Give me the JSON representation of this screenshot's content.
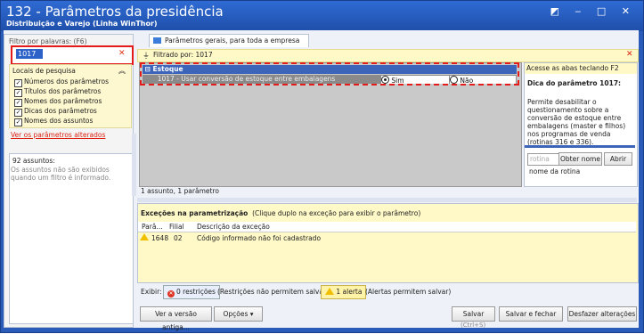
{
  "window": {
    "title": "132 - Parâmetros da presidência",
    "subtitle": "Distribuição e Varejo (Linha WinThor)",
    "controls": "◩ ‒ □ ✕"
  },
  "left": {
    "filter_label": "Filtro por palavras: (F6)",
    "filter_value": "1017",
    "search_places_title": "Locais de pesquisa",
    "search_places": [
      "Números dos parâmetros",
      "Títulos dos parâmetros",
      "Nomes dos parâmetros",
      "Dicas dos parâmetros",
      "Nomes dos assuntos"
    ],
    "altered_link": "Ver os parâmetros alterados",
    "subjects_count": "92 assuntos:",
    "subjects_note": "Os assuntos não são exibidos quando um filtro é informado."
  },
  "tabs": [
    "Parâmetros gerais, para toda a empresa  (1)"
  ],
  "filter_bar": "Filtrado por: 1017",
  "grid": {
    "group": "Estoque",
    "param": "1017 - Usar conversão de estoque entre embalagens",
    "opt_yes": "Sim",
    "opt_no": "Não",
    "selected": "Sim",
    "count": "1 assunto, 1 parâmetro"
  },
  "right": {
    "tip_top": "Acesse as abas teclando F2",
    "tip_title": "Dica do parâmetro 1017:",
    "tip_text": "Permite desabilitar o questionamento sobre a conversão de estoque entre embalagens (master e filhos) nos programas de venda (rotinas 316 e 336).",
    "rotina_placeholder": "rotina",
    "btn_obter": "Obter nome",
    "btn_abrir": "Abrir",
    "nome_rotina": "nome da rotina"
  },
  "exceptions": {
    "title": "Exceções na parametrização",
    "hint": "(Clique duplo na exceção para exibir o parâmetro)",
    "columns": [
      "Parâ...",
      "Filial",
      "Descrição da exceção"
    ],
    "rows": [
      {
        "param": "1648",
        "filial": "02",
        "desc": "Código informado não foi cadastrado"
      }
    ],
    "exibir": "Exibir:",
    "restr_label": "0 restrições",
    "restr_hint": "(Restrições não permitem salvar)",
    "alert_label": "1 alerta",
    "alert_hint": "(Alertas permitem salvar)"
  },
  "bottom": {
    "btn_old": "Ver a versão antiga...",
    "btn_options": "Opções ▾",
    "btn_save": "Salvar",
    "save_shortcut": "(Ctrl+S)",
    "btn_save_close": "Salvar e fechar",
    "btn_undo": "Desfazer alterações"
  },
  "colors": {
    "accent": "#3c64b8",
    "highlight": "#e31b1b",
    "tip_bg": "#fff9c8"
  }
}
